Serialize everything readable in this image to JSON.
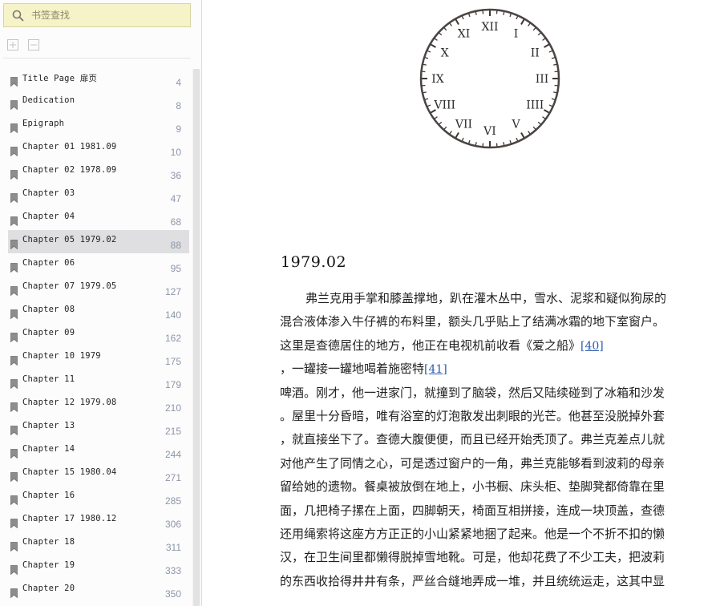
{
  "sidebar": {
    "search_placeholder": "书签查找",
    "toc": [
      {
        "label": "Title Page 扉页",
        "page": "4"
      },
      {
        "label": "Dedication",
        "page": "8"
      },
      {
        "label": "Epigraph",
        "page": "9"
      },
      {
        "label": "Chapter 01 1981.09",
        "page": "10"
      },
      {
        "label": "Chapter 02 1978.09",
        "page": "36"
      },
      {
        "label": "Chapter 03",
        "page": "47"
      },
      {
        "label": "Chapter 04",
        "page": "68"
      },
      {
        "label": "Chapter 05 1979.02",
        "page": "88"
      },
      {
        "label": "Chapter 06",
        "page": "95"
      },
      {
        "label": "Chapter 07 1979.05",
        "page": "127"
      },
      {
        "label": "Chapter 08",
        "page": "140"
      },
      {
        "label": "Chapter 09",
        "page": "162"
      },
      {
        "label": "Chapter 10 1979",
        "page": "175"
      },
      {
        "label": "Chapter 11",
        "page": "179"
      },
      {
        "label": "Chapter 12 1979.08",
        "page": "210"
      },
      {
        "label": "Chapter 13",
        "page": "215"
      },
      {
        "label": "Chapter 14",
        "page": "244"
      },
      {
        "label": "Chapter 15 1980.04",
        "page": "271"
      },
      {
        "label": "Chapter 16",
        "page": "285"
      },
      {
        "label": "Chapter 17 1980.12",
        "page": "306"
      },
      {
        "label": "Chapter 18",
        "page": "311"
      },
      {
        "label": "Chapter 19",
        "page": "333"
      },
      {
        "label": "Chapter 20",
        "page": "350"
      }
    ],
    "active_index": 7
  },
  "reader": {
    "clock_numerals": [
      "XII",
      "I",
      "II",
      "III",
      "IIII",
      "V",
      "VI",
      "VII",
      "VIII",
      "IX",
      "X",
      "XI"
    ],
    "chapter_title": "1979.02",
    "lines": [
      "弗兰克用手掌和膝盖撑地，趴在灌木丛中，雪水、泥浆和疑似狗尿的",
      "混合液体渗入牛仔裤的布料里，额头几乎贴上了结满冰霜的地下室窗户。",
      "这里是查德居住的地方，他正在电视机前收看《爱之船》",
      "，一罐接一罐地喝着施密特",
      "啤酒。刚才，他一进家门，就撞到了脑袋，然后又陆续碰到了冰箱和沙发",
      "。屋里十分昏暗，唯有浴室的灯泡散发出刺眼的光芒。他甚至没脱掉外套",
      "，就直接坐下了。查德大腹便便，而且已经开始秃顶了。弗兰克差点儿就",
      "对他产生了同情之心，可是透过窗户的一角，弗兰克能够看到波莉的母亲",
      "留给她的遗物。餐桌被放倒在地上，小书橱、床头柜、垫脚凳都倚靠在里",
      "面，几把椅子摞在上面，四脚朝天，椅面互相拼接，连成一块顶盖，查德",
      "还用绳索将这座方方正正的小山紧紧地捆了起来。他是一个不折不扣的懒",
      "汉，在卫生间里都懒得脱掉雪地靴。可是，他却花费了不少工夫，把波莉",
      "的东西收拾得井井有条，严丝合缝地弄成一堆，并且统统运走，这其中显"
    ],
    "footnotes": {
      "fn40": "[40]",
      "fn41": "[41]"
    }
  }
}
